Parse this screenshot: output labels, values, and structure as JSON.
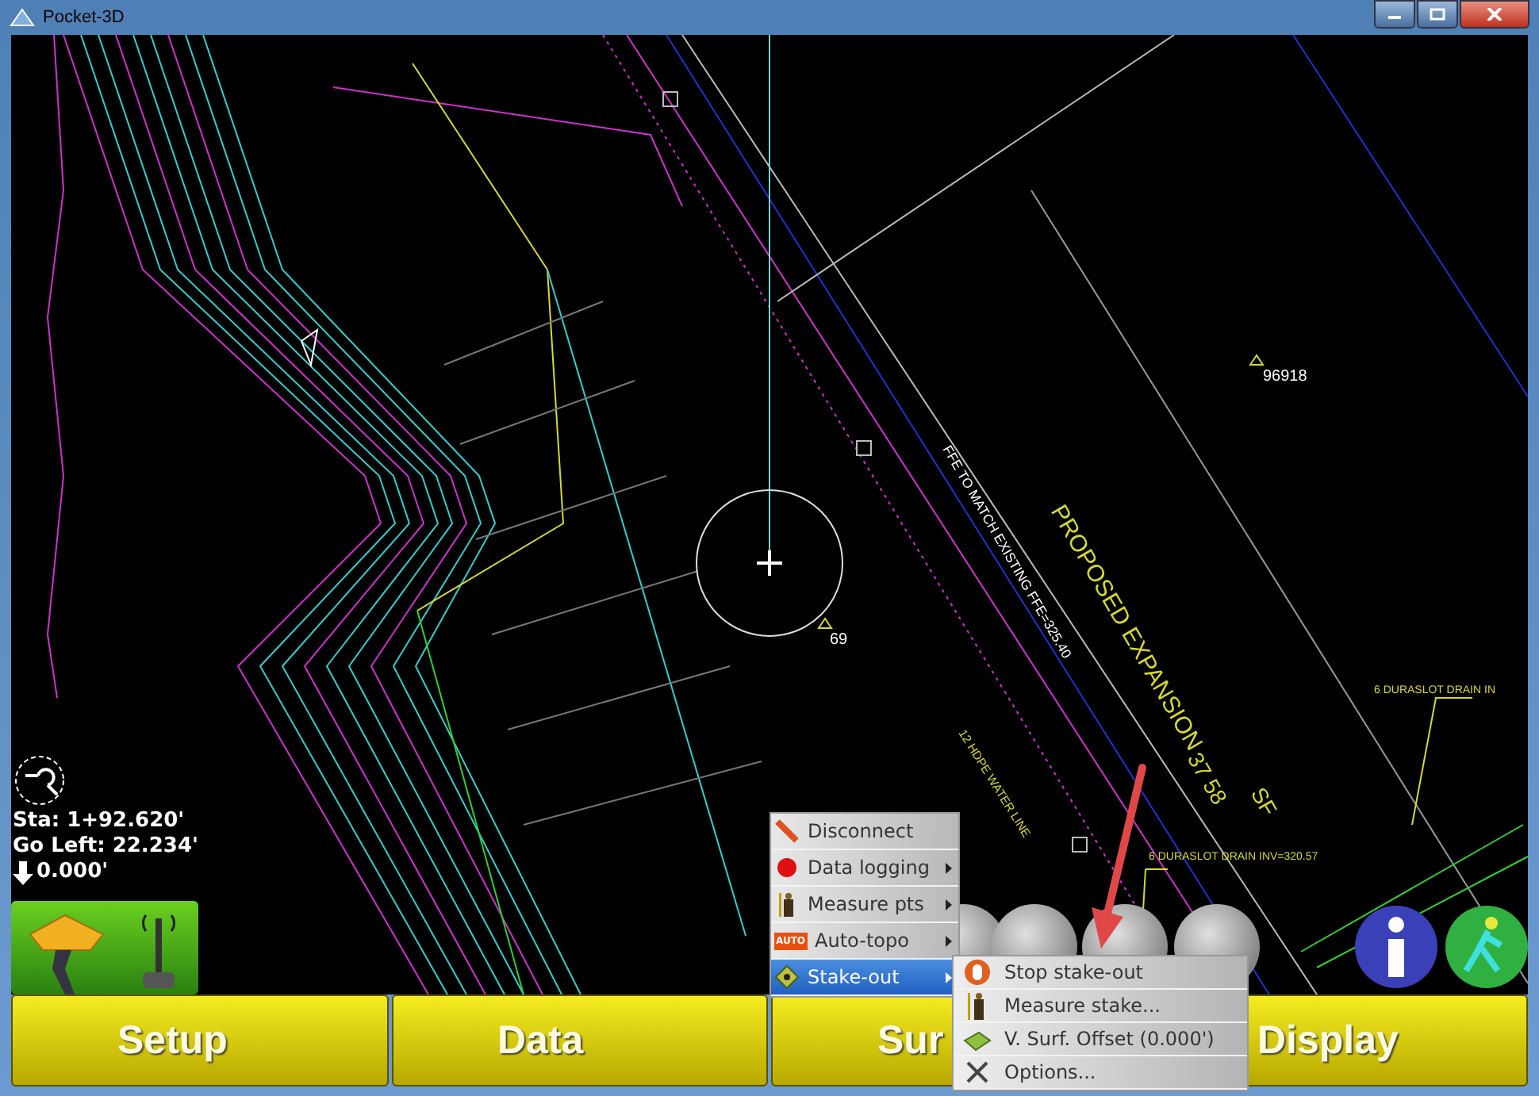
{
  "window": {
    "title": "Pocket-3D"
  },
  "status": {
    "station": "Sta: 1+92.620'",
    "offset": "Go Left: 22.234'",
    "elevation": "0.000'"
  },
  "cad_labels": [
    {
      "text": "96918"
    },
    {
      "text": "69"
    },
    {
      "text": "FFE TO MATCH EXISTING FFE=325.40"
    },
    {
      "text": "PROPOSED EXPANSION"
    },
    {
      "text": "37 58"
    },
    {
      "text": "SF"
    },
    {
      "text": "12 HDPE WATER LINE"
    },
    {
      "text": "6 DURASLOT DRAIN INV=320.57"
    },
    {
      "text": "6 DURASLOT DRAIN IN"
    }
  ],
  "menu": {
    "items": [
      {
        "label": "Disconnect",
        "has_submenu": false,
        "selected": false
      },
      {
        "label": "Data logging",
        "has_submenu": true,
        "selected": false
      },
      {
        "label": "Measure pts",
        "has_submenu": true,
        "selected": false
      },
      {
        "label": "Auto-topo",
        "icon_text": "AUTO",
        "has_submenu": true,
        "selected": false
      },
      {
        "label": "Stake-out",
        "has_submenu": true,
        "selected": true
      }
    ]
  },
  "submenu": {
    "items": [
      {
        "label": "Stop stake-out"
      },
      {
        "label": "Measure stake..."
      },
      {
        "label": "V. Surf. Offset (0.000')"
      },
      {
        "label": "Options..."
      }
    ]
  },
  "buttons": [
    {
      "label": "Setup"
    },
    {
      "label": "Data"
    },
    {
      "label": "Sur"
    },
    {
      "label": "Display"
    }
  ]
}
